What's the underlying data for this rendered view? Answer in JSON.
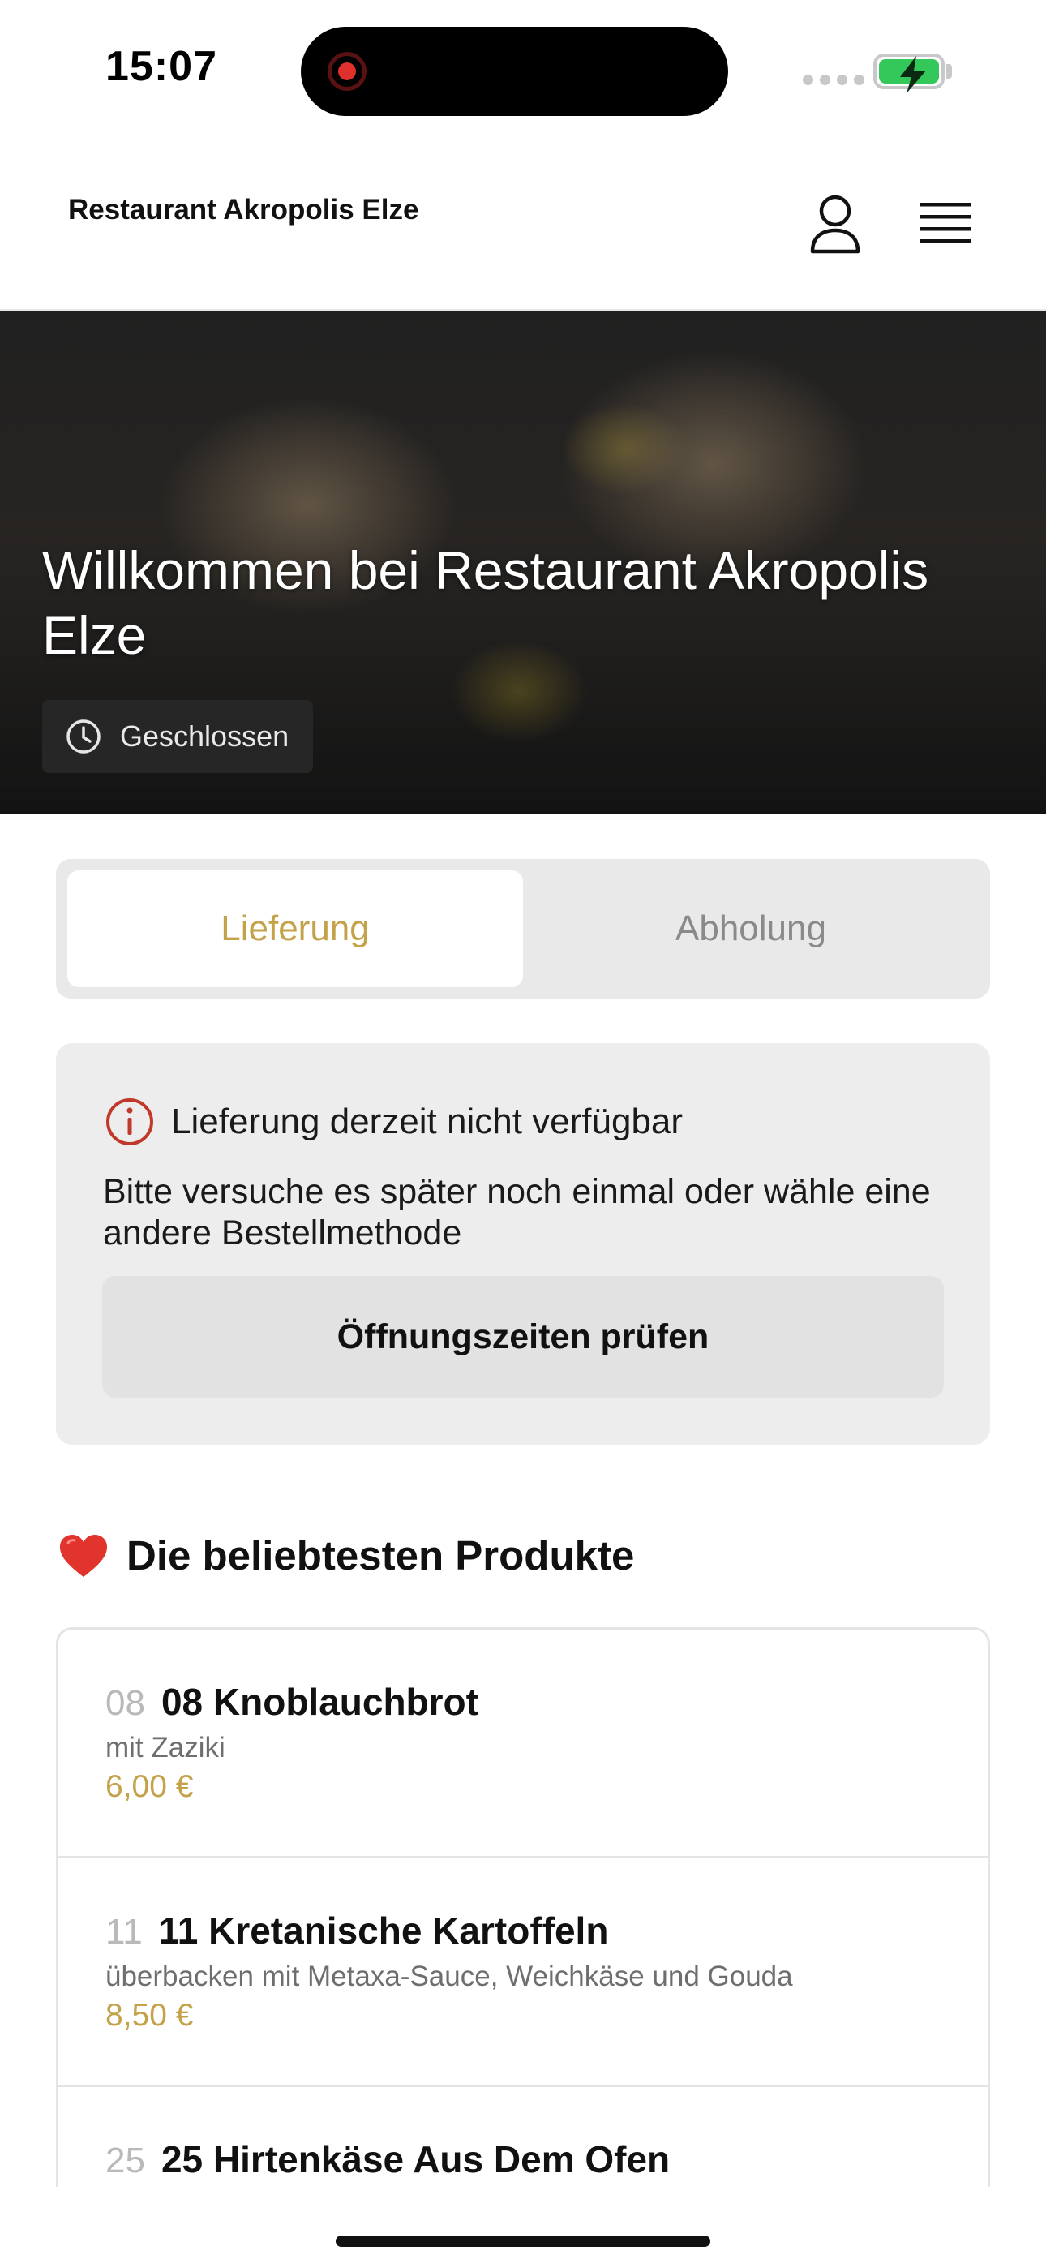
{
  "status_bar": {
    "time": "15:07",
    "battery_color": "#34c759",
    "recording_color": "#e0302b"
  },
  "header": {
    "brand": "Restaurant Akropolis Elze",
    "icons": [
      "user-icon",
      "hamburger-menu-icon"
    ]
  },
  "hero": {
    "title": "Willkommen bei Restaurant Akropolis Elze",
    "status_label": "Geschlossen",
    "status_icon": "clock-icon"
  },
  "order_method": {
    "options": [
      {
        "label": "Lieferung",
        "selected": true
      },
      {
        "label": "Abholung",
        "selected": false
      }
    ],
    "accent_color": "#c4a24a"
  },
  "notice": {
    "icon": "info-icon",
    "icon_color": "#c0392b",
    "title": "Lieferung derzeit nicht verfügbar",
    "text": "Bitte versuche es später noch einmal oder wähle eine andere Bestellmethode",
    "button_label": "Öffnungszeiten prüfen"
  },
  "popular": {
    "icon": "heart-icon",
    "title": "Die beliebtesten Produkte",
    "products": [
      {
        "number": "08",
        "name": "08 Knoblauchbrot",
        "description": "mit Zaziki",
        "price": "6,00 €"
      },
      {
        "number": "11",
        "name": "11 Kretanische Kartoffeln",
        "description": "überbacken mit Metaxa-Sauce, Weichkäse und Gouda",
        "price": "8,50 €"
      },
      {
        "number": "25",
        "name": "25 Hirtenkäse Aus Dem Ofen",
        "description": "",
        "price": ""
      }
    ]
  }
}
